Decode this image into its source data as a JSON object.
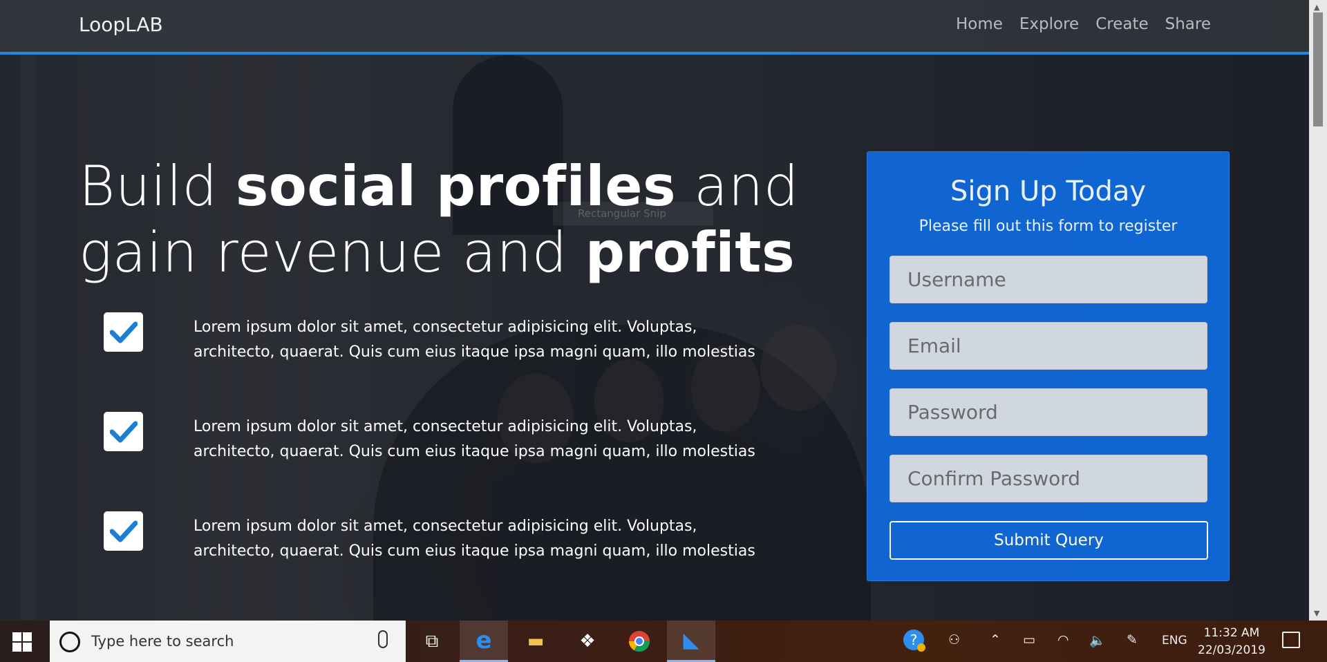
{
  "navbar": {
    "brand": "LoopLAB",
    "links": [
      "Home",
      "Explore",
      "Create",
      "Share"
    ]
  },
  "hero": {
    "headline_parts": [
      "Build ",
      "social profiles",
      " and gain revenue and ",
      "profits"
    ],
    "features": [
      "Lorem ipsum dolor sit amet, consectetur adipisicing elit. Voluptas, architecto, quaerat. Quis cum eius itaque ipsa magni quam, illo molestias",
      "Lorem ipsum dolor sit amet, consectetur adipisicing elit. Voluptas, architecto, quaerat. Quis cum eius itaque ipsa magni quam, illo molestias",
      "Lorem ipsum dolor sit amet, consectetur adipisicing elit. Voluptas, architecto, quaerat. Quis cum eius itaque ipsa magni quam, illo molestias"
    ],
    "ghost_tooltip": "Rectangular Snip"
  },
  "signup": {
    "title": "Sign Up Today",
    "subtitle": "Please fill out this form to register",
    "fields": {
      "username": "Username",
      "email": "Email",
      "password": "Password",
      "confirm": "Confirm Password"
    },
    "submit": "Submit Query"
  },
  "taskbar": {
    "search_placeholder": "Type here to search",
    "language": "ENG",
    "time": "11:32 AM",
    "date": "22/03/2019",
    "icons": [
      "windows-start",
      "task-view",
      "edge",
      "file-explorer",
      "dropbox",
      "chrome",
      "vscode",
      "help",
      "people",
      "show-hidden",
      "battery",
      "wifi",
      "volume",
      "pen",
      "action-center"
    ]
  },
  "colors": {
    "accent": "#1e88e5",
    "card": "#0e6ee8",
    "check": "#1a7fd0"
  }
}
